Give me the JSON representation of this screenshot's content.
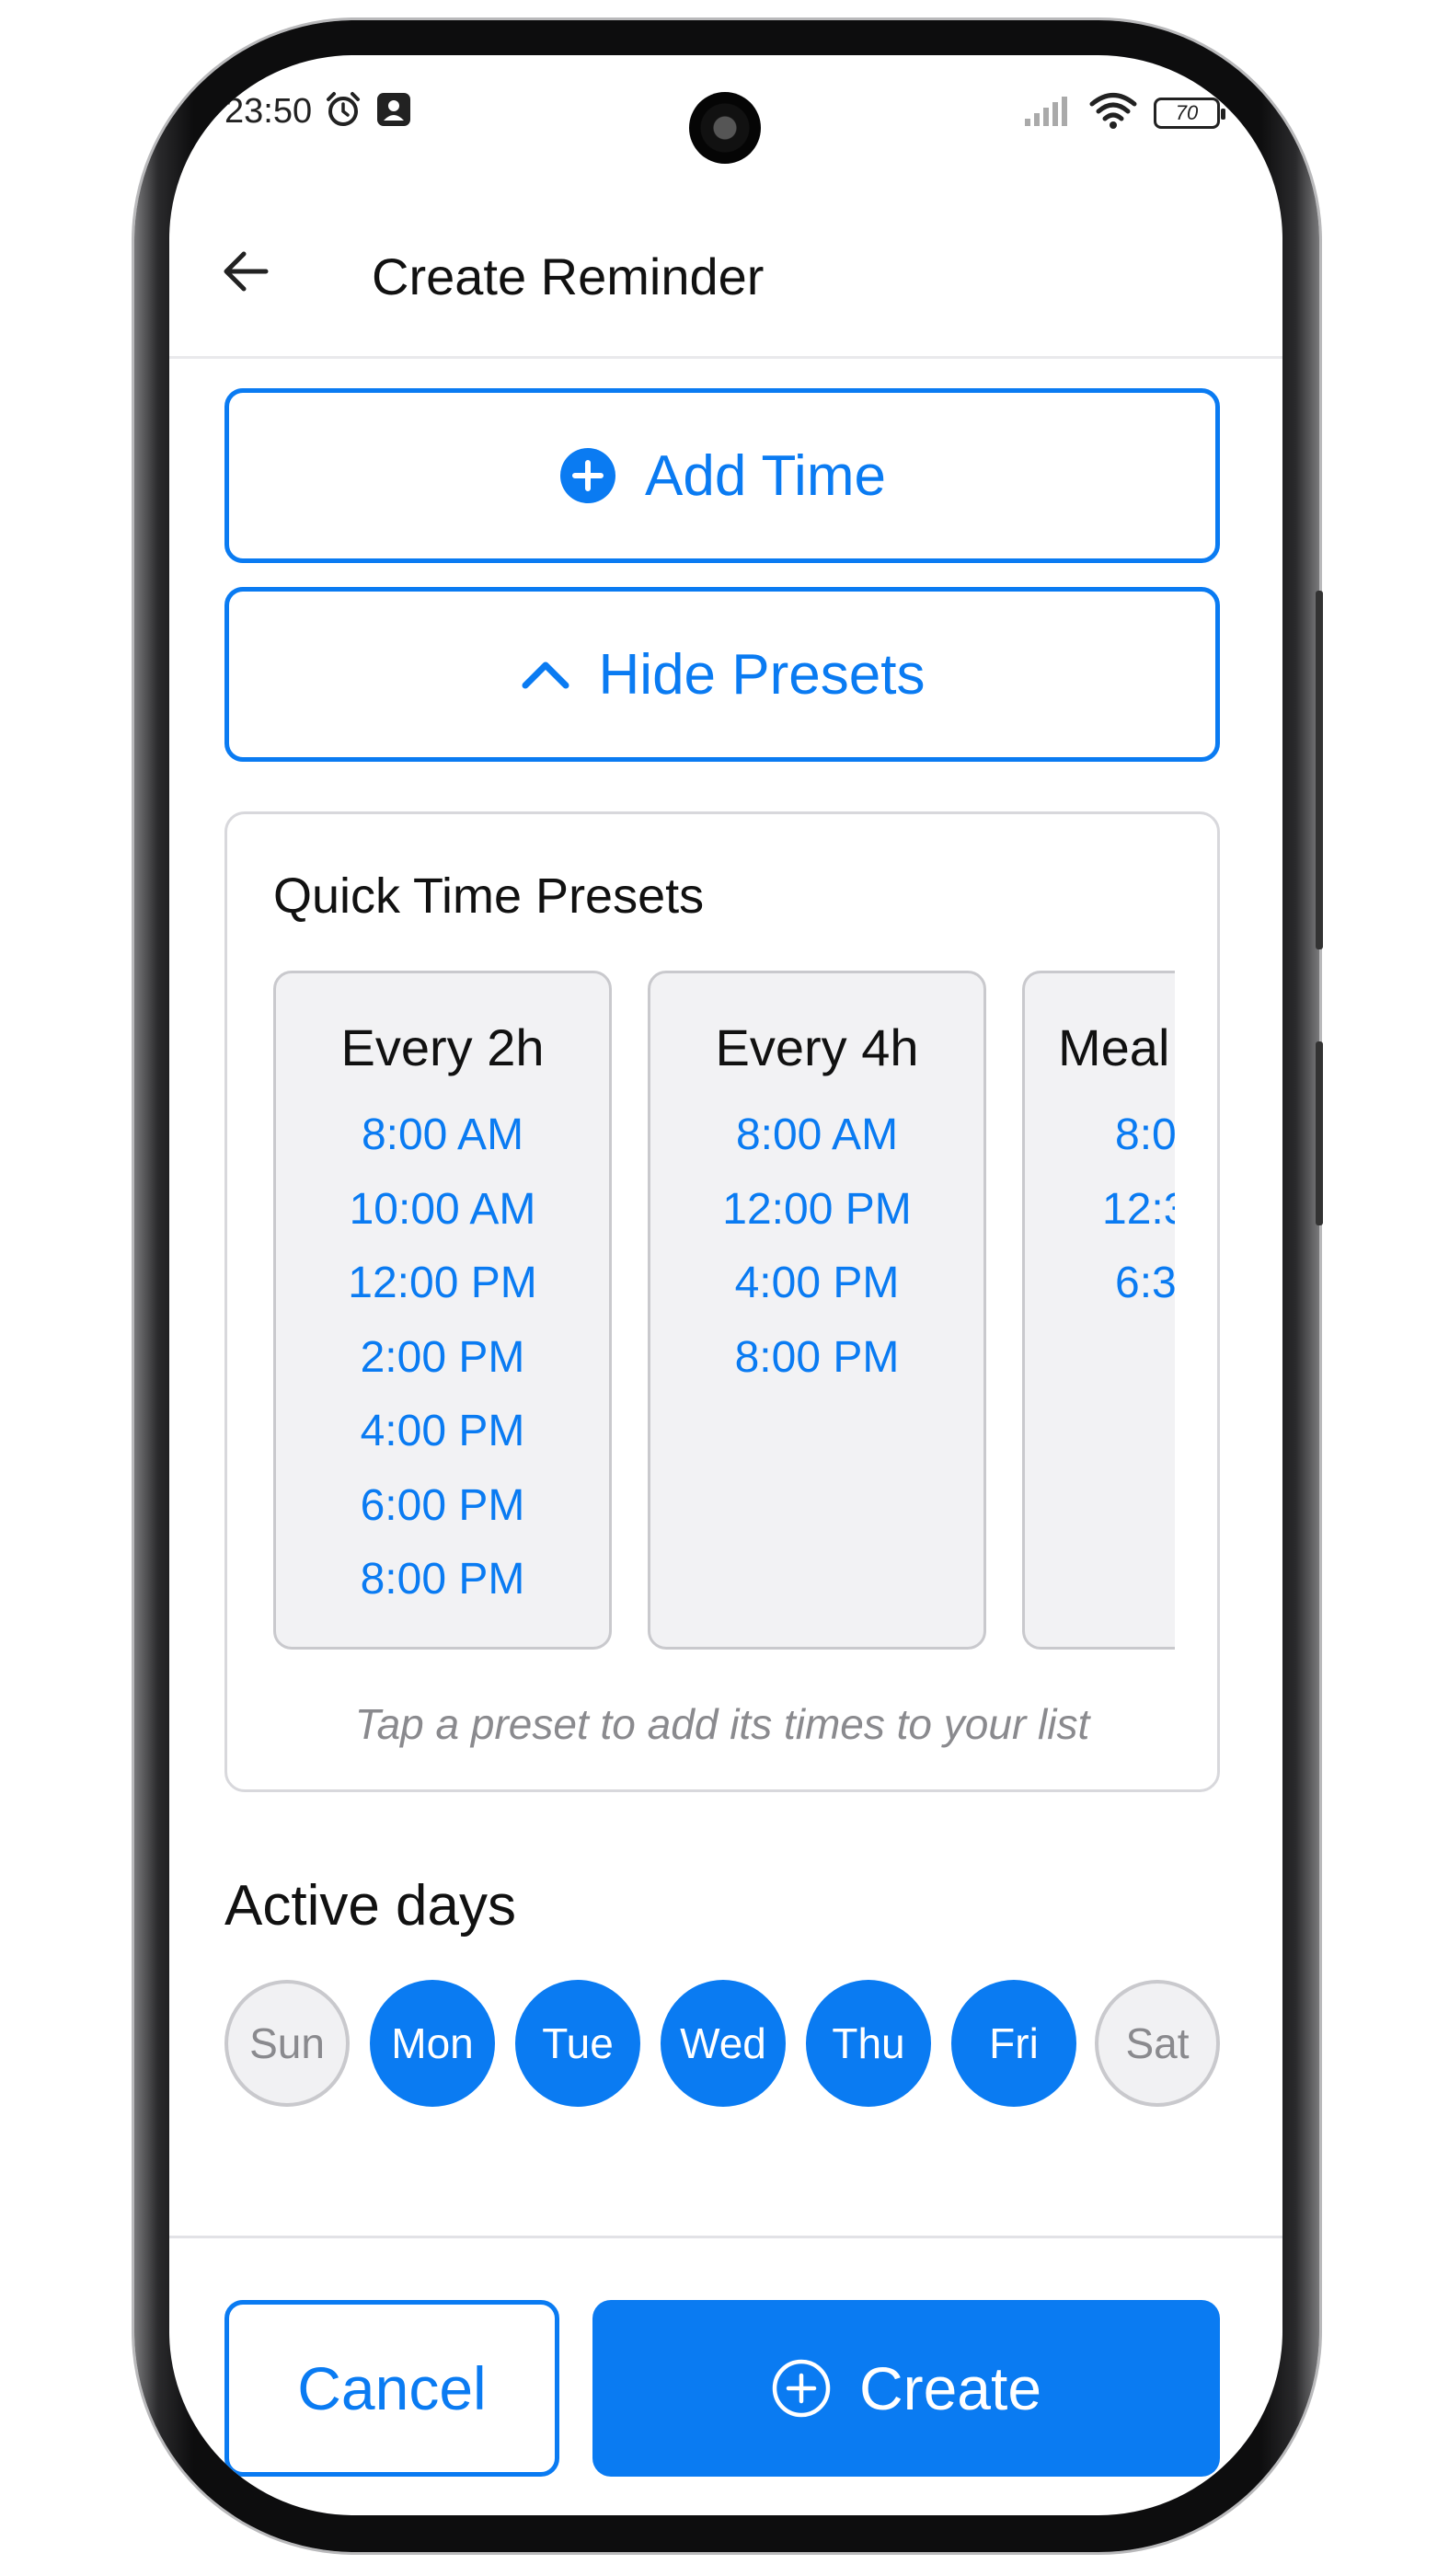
{
  "status_bar": {
    "time": "23:50",
    "battery": "70",
    "icons": [
      "alarm-icon",
      "notification-icon",
      "signal-icon",
      "wifi-icon",
      "battery-icon"
    ]
  },
  "header": {
    "title": "Create Reminder",
    "back_icon": "arrow-left-icon"
  },
  "actions": {
    "add_time_label": "Add Time",
    "add_time_icon": "plus-circle-icon",
    "hide_presets_label": "Hide Presets",
    "hide_presets_icon": "chevron-up-icon"
  },
  "presets": {
    "title": "Quick Time Presets",
    "items": [
      {
        "name": "Every 2h",
        "times": [
          "8:00 AM",
          "10:00 AM",
          "12:00 PM",
          "2:00 PM",
          "4:00 PM",
          "6:00 PM",
          "8:00 PM"
        ]
      },
      {
        "name": "Every 4h",
        "times": [
          "8:00 AM",
          "12:00 PM",
          "4:00 PM",
          "8:00 PM"
        ]
      },
      {
        "name": "Meal",
        "times": [
          "8:0",
          "12:3",
          "6:3"
        ]
      }
    ],
    "hint": "Tap a preset to add its times to your list"
  },
  "active_days": {
    "title": "Active days",
    "days": [
      {
        "label": "Sun",
        "selected": false
      },
      {
        "label": "Mon",
        "selected": true
      },
      {
        "label": "Tue",
        "selected": true
      },
      {
        "label": "Wed",
        "selected": true
      },
      {
        "label": "Thu",
        "selected": true
      },
      {
        "label": "Fri",
        "selected": true
      },
      {
        "label": "Sat",
        "selected": false
      }
    ]
  },
  "footer": {
    "cancel_label": "Cancel",
    "create_label": "Create",
    "create_icon": "plus-circle-icon"
  },
  "colors": {
    "accent": "#0a7bf2",
    "muted_text": "#8a8a8e",
    "card_bg": "#f2f2f4",
    "border": "#c9c9cd"
  }
}
